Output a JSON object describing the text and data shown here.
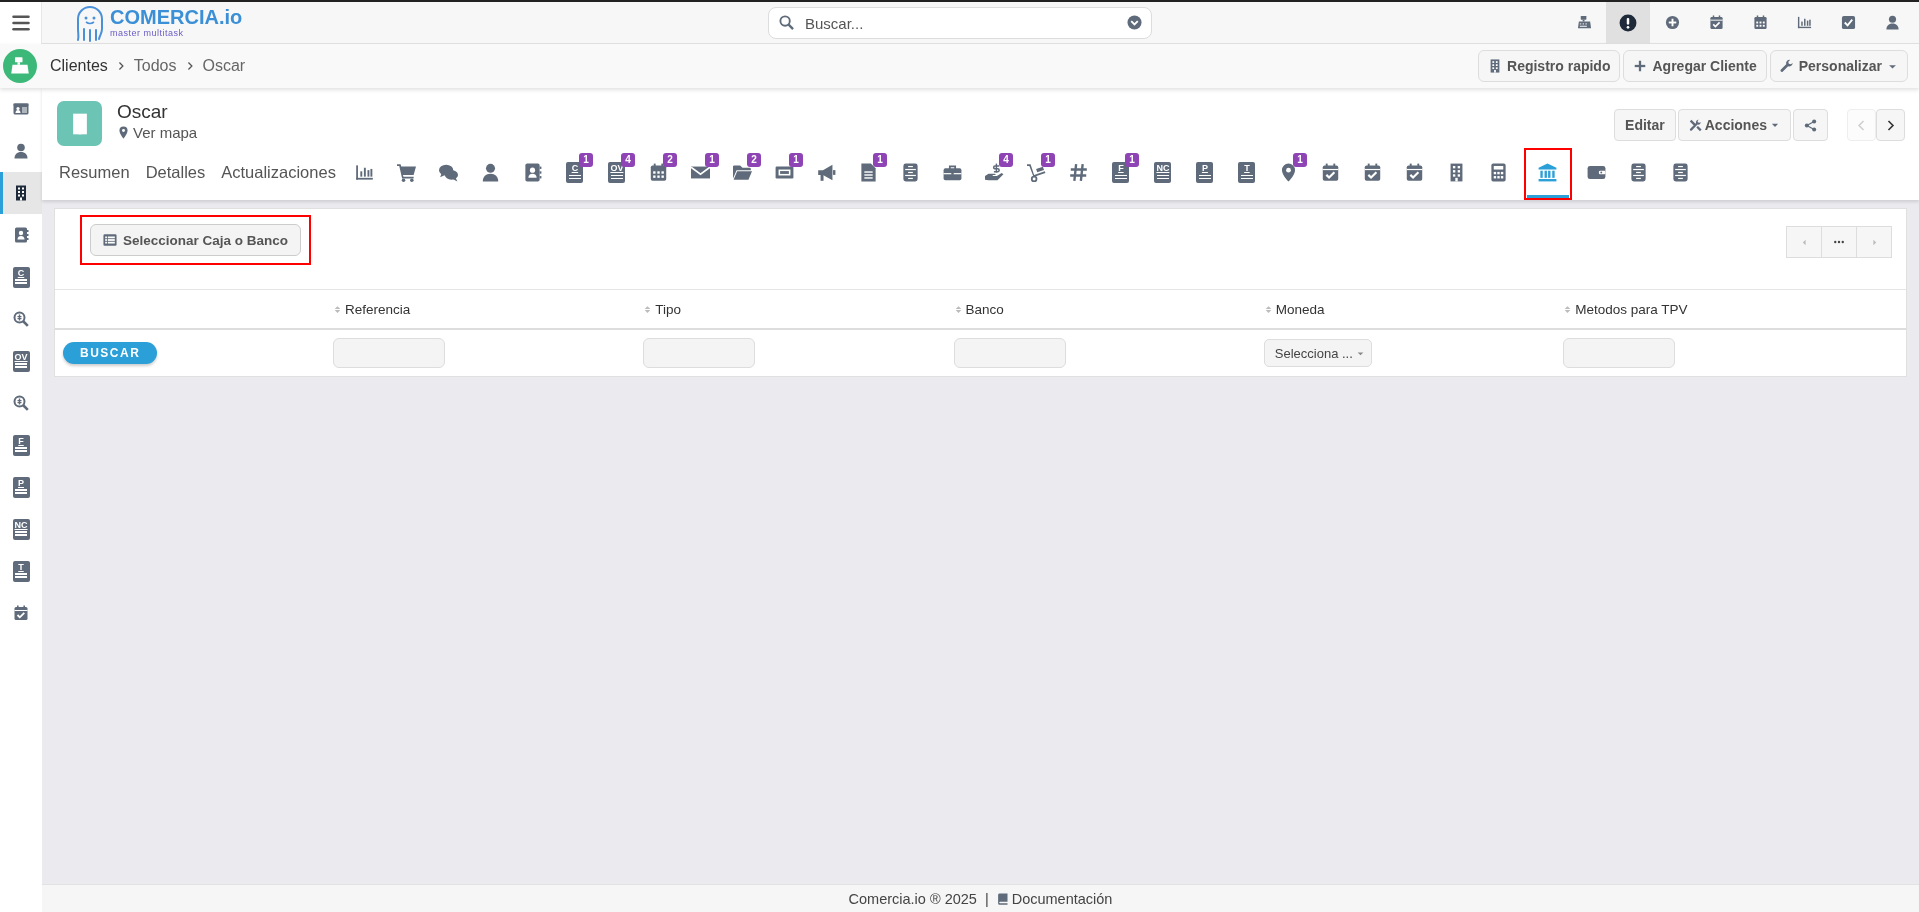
{
  "topbar": {
    "logo": {
      "name": "COMERCIA.io",
      "tagline": "master multitask"
    },
    "search": {
      "placeholder": "Buscar..."
    },
    "icons": [
      {
        "selected": false
      },
      {
        "selected": true
      },
      {
        "selected": false
      },
      {
        "selected": false
      },
      {
        "selected": false
      },
      {
        "selected": false
      },
      {
        "selected": false
      },
      {
        "selected": false
      }
    ]
  },
  "breadcrumb": [
    "Clientes",
    "Todos",
    "Oscar"
  ],
  "header_buttons": [
    {
      "label": "Registro rapido",
      "dropdown": false
    },
    {
      "label": "Agregar Cliente",
      "dropdown": false
    },
    {
      "label": "Personalizar",
      "dropdown": true
    }
  ],
  "sidebar": {
    "items": [
      {
        "selected": false
      },
      {
        "selected": false
      },
      {
        "selected": true
      },
      {
        "selected": false
      },
      {
        "letter": "C",
        "selected": false
      },
      {
        "selected": false
      },
      {
        "letter": "OV",
        "selected": false
      },
      {
        "selected": false
      },
      {
        "letter": "F",
        "selected": false
      },
      {
        "letter": "P",
        "selected": false
      },
      {
        "letter": "NC",
        "selected": false
      },
      {
        "letter": "T",
        "selected": false
      },
      {
        "selected": false
      }
    ]
  },
  "record": {
    "name": "Oscar",
    "map_link": "Ver mapa",
    "actions": [
      {
        "kind": "text",
        "label": "Editar"
      },
      {
        "kind": "dropdown",
        "label": "Acciones"
      },
      {
        "kind": "share"
      }
    ],
    "pager": [
      {
        "kind": "prev",
        "disabled": true
      },
      {
        "kind": "next",
        "disabled": false
      }
    ]
  },
  "tabs": [
    {
      "kind": "text",
      "label": "Resumen",
      "selected": false
    },
    {
      "kind": "text",
      "label": "Detalles",
      "selected": false
    },
    {
      "kind": "text",
      "label": "Actualizaciones",
      "selected": false
    },
    {
      "kind": "icon",
      "selected": false
    },
    {
      "kind": "icon",
      "selected": false
    },
    {
      "kind": "icon",
      "selected": false
    },
    {
      "kind": "icon",
      "selected": false
    },
    {
      "kind": "icon",
      "selected": false
    },
    {
      "kind": "icon",
      "letter": "C",
      "badge": "1",
      "selected": false
    },
    {
      "kind": "icon",
      "letter": "OV",
      "badge": "4",
      "selected": false
    },
    {
      "kind": "icon",
      "badge": "2",
      "selected": false
    },
    {
      "kind": "icon",
      "badge": "1",
      "selected": false
    },
    {
      "kind": "icon",
      "badge": "2",
      "selected": false
    },
    {
      "kind": "icon",
      "badge": "1",
      "selected": false
    },
    {
      "kind": "icon",
      "selected": false
    },
    {
      "kind": "icon",
      "badge": "1",
      "selected": false
    },
    {
      "kind": "icon",
      "selected": false
    },
    {
      "kind": "icon",
      "selected": false
    },
    {
      "kind": "icon",
      "badge": "4",
      "selected": false
    },
    {
      "kind": "icon",
      "badge": "1",
      "selected": false
    },
    {
      "kind": "icon",
      "selected": false
    },
    {
      "kind": "icon",
      "letter": "F",
      "badge": "1",
      "selected": false
    },
    {
      "kind": "icon",
      "letter": "NC",
      "selected": false
    },
    {
      "kind": "icon",
      "letter": "P",
      "selected": false
    },
    {
      "kind": "icon",
      "letter": "T",
      "selected": false
    },
    {
      "kind": "icon",
      "badge": "1",
      "selected": false
    },
    {
      "kind": "icon",
      "selected": false
    },
    {
      "kind": "icon",
      "selected": false
    },
    {
      "kind": "icon",
      "selected": false
    },
    {
      "kind": "icon",
      "selected": false
    },
    {
      "kind": "icon",
      "selected": false
    },
    {
      "kind": "icon",
      "selected": true,
      "highlighted": true
    },
    {
      "kind": "icon",
      "selected": false
    },
    {
      "kind": "icon",
      "selected": false
    },
    {
      "kind": "icon",
      "selected": false
    }
  ],
  "panel": {
    "select_button": {
      "label": "Seleccionar Caja o Banco",
      "highlighted": true
    },
    "pager": [
      {
        "kind": "prev",
        "disabled": true
      },
      {
        "kind": "more",
        "disabled": false
      },
      {
        "kind": "next",
        "disabled": true
      }
    ],
    "table": {
      "columns": [
        {
          "kind": "button",
          "value": "BUSCAR"
        },
        {
          "label": "Referencia",
          "kind": "input"
        },
        {
          "label": "Tipo",
          "kind": "input"
        },
        {
          "label": "Banco",
          "kind": "input"
        },
        {
          "label": "Moneda",
          "kind": "select",
          "value": "Selecciona ..."
        },
        {
          "label": "Metodos para TPV",
          "kind": "input"
        }
      ]
    }
  },
  "footer": {
    "copyright": "Comercia.io ® 2025",
    "separator": "|",
    "link": "Documentación"
  }
}
